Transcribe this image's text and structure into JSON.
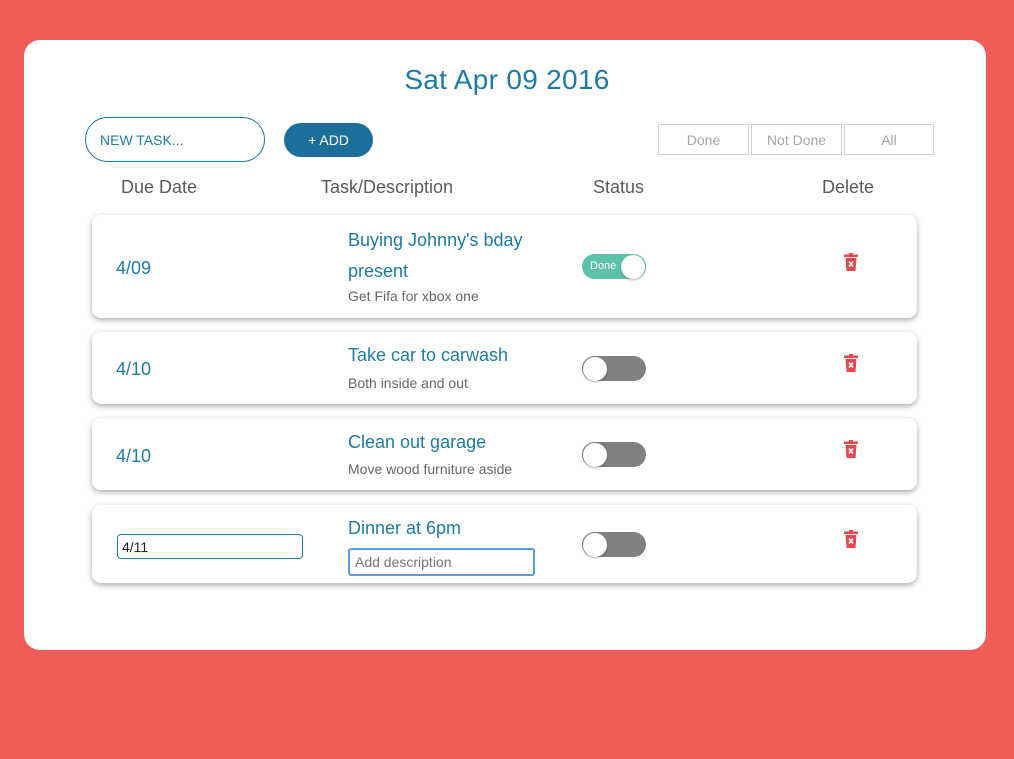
{
  "header": {
    "date": "Sat Apr 09 2016"
  },
  "toolbar": {
    "new_task_placeholder": "NEW TASK...",
    "add_label": "+ ADD",
    "filters": [
      "Done",
      "Not Done",
      "All"
    ]
  },
  "columns": {
    "due": "Due Date",
    "task": "Task/Description",
    "status": "Status",
    "delete": "Delete"
  },
  "tasks": [
    {
      "due": "4/09",
      "title": "Buying Johnny's bday present",
      "description": "Get Fifa for xbox one",
      "done": true,
      "status_label": "Done"
    },
    {
      "due": "4/10",
      "title": "Take car to carwash",
      "description": "Both inside and out",
      "done": false
    },
    {
      "due": "4/10",
      "title": "Clean out garage",
      "description": "Move wood furniture aside",
      "done": false
    },
    {
      "due_input_value": "4/11",
      "title": "Dinner at 6pm",
      "description_placeholder": "Add description",
      "done": false
    }
  ],
  "colors": {
    "background": "#f25c58",
    "accent": "#1d7ba6",
    "button": "#1c6f9a",
    "toggle_on": "#5ec1ab",
    "toggle_off": "#808080",
    "delete": "#e8474c"
  },
  "icons": {
    "delete": "trash-icon"
  }
}
